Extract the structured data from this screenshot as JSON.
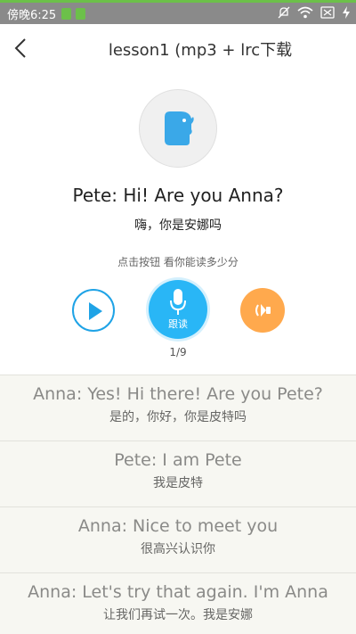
{
  "status_bar": {
    "time": "傍晚6:25"
  },
  "header": {
    "title": "lesson1 (mp3 + lrc下载"
  },
  "current": {
    "english": "Pete: Hi! Are you Anna?",
    "chinese": "嗨，你是安娜吗"
  },
  "hint": "点击按钮 看你能读多少分",
  "controls": {
    "record_label": "跟读",
    "progress": "1/9"
  },
  "colors": {
    "accent_blue": "#29b6f6",
    "play_blue": "#1fa3e6",
    "replay_orange": "#ffa94d",
    "status_green": "#6cc04a"
  },
  "sentences": [
    {
      "english": "Anna: Yes! Hi there! Are you Pete?",
      "chinese": "是的，你好，你是皮特吗"
    },
    {
      "english": "Pete: I am Pete",
      "chinese": "我是皮特"
    },
    {
      "english": "Anna: Nice to meet you",
      "chinese": "很高兴认识你"
    },
    {
      "english": "Anna: Let's try that again. I'm Anna",
      "chinese": "让我们再试一次。我是安娜"
    }
  ]
}
